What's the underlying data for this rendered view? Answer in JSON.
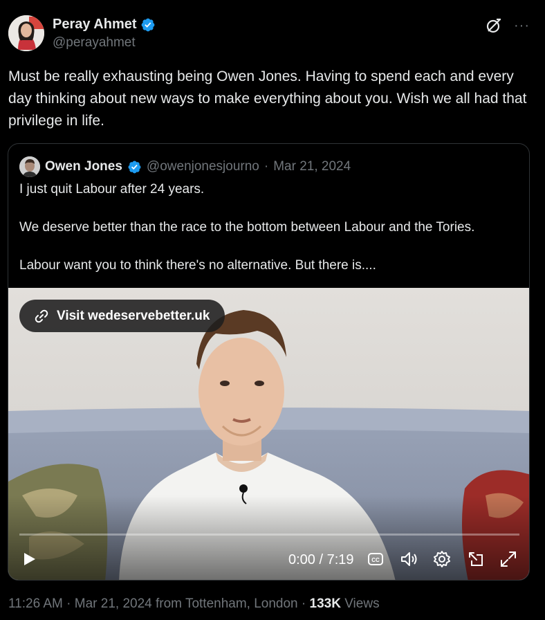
{
  "author": {
    "display_name": "Peray Ahmet",
    "handle": "@perayahmet",
    "verified": true,
    "verified_color": "#1d9bf0"
  },
  "header_icons": [
    "grok-icon",
    "more-icon"
  ],
  "more_label": "···",
  "tweet": {
    "text": "Must be really exhausting being Owen Jones. Having to spend each and every day thinking about new ways to make everything about you. Wish we all had that privilege in life."
  },
  "quote": {
    "display_name": "Owen Jones",
    "handle": "@owenjonesjourno",
    "separator": "·",
    "date": "Mar 21, 2024",
    "verified": true,
    "paragraphs": [
      "I just quit Labour after 24 years.",
      "We deserve better than the race to the bottom between Labour and the Tories.",
      "Labour want you to think there's no alternative. But there is...."
    ],
    "video": {
      "link_label": "Visit wedeservebetter.uk",
      "time": "0:00 / 7:19",
      "progress": 0,
      "controls": [
        "play-icon",
        "captions-icon",
        "volume-icon",
        "settings-icon",
        "pip-icon",
        "fullscreen-icon"
      ]
    }
  },
  "meta": {
    "time": "11:26 AM",
    "sep1": " · ",
    "date": "Mar 21, 2024",
    "location": " from Tottenham, London",
    "sep2": " · ",
    "views_count": "133K",
    "views_label": " Views"
  }
}
